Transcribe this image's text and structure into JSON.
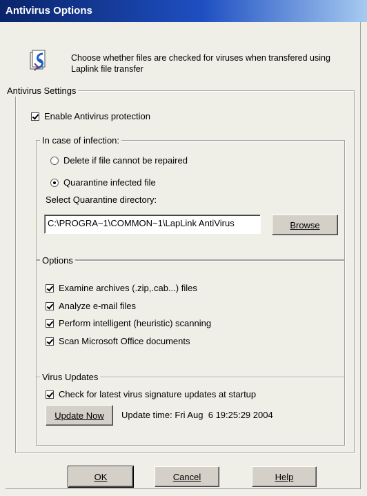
{
  "window": {
    "title": "Antivirus Options"
  },
  "header": {
    "icon": "laplink-icon",
    "description": "Choose whether files are checked for viruses when transfered using Laplink file transfer"
  },
  "antivirus_settings": {
    "label": "Antivirus Settings",
    "enable": {
      "label": "Enable Antivirus protection",
      "checked": true
    }
  },
  "infection": {
    "label": "In case of infection:",
    "delete": {
      "label": "Delete if file cannot be repaired",
      "selected": false
    },
    "quarantine": {
      "label": "Quarantine infected file",
      "selected": true
    },
    "dir_label": "Select Quarantine directory:",
    "dir_value": "C:\\PROGRA~1\\COMMON~1\\LapLink AntiVirus",
    "browse_label": "Browse"
  },
  "options": {
    "label": "Options",
    "items": [
      {
        "label": "Examine archives (.zip,.cab...) files",
        "checked": true
      },
      {
        "label": "Analyze e-mail files",
        "checked": true
      },
      {
        "label": "Perform intelligent (heuristic) scanning",
        "checked": true
      },
      {
        "label": "Scan Microsoft Office documents",
        "checked": true
      }
    ]
  },
  "updates": {
    "label": "Virus Updates",
    "check_label": "Check for latest virus signature updates at startup",
    "checked": true,
    "update_now_label": "Update Now",
    "update_time": "Update time: Fri Aug  6 19:25:29 2004"
  },
  "footer": {
    "ok_label": "OK",
    "cancel_label": "Cancel",
    "help_label": "Help"
  }
}
